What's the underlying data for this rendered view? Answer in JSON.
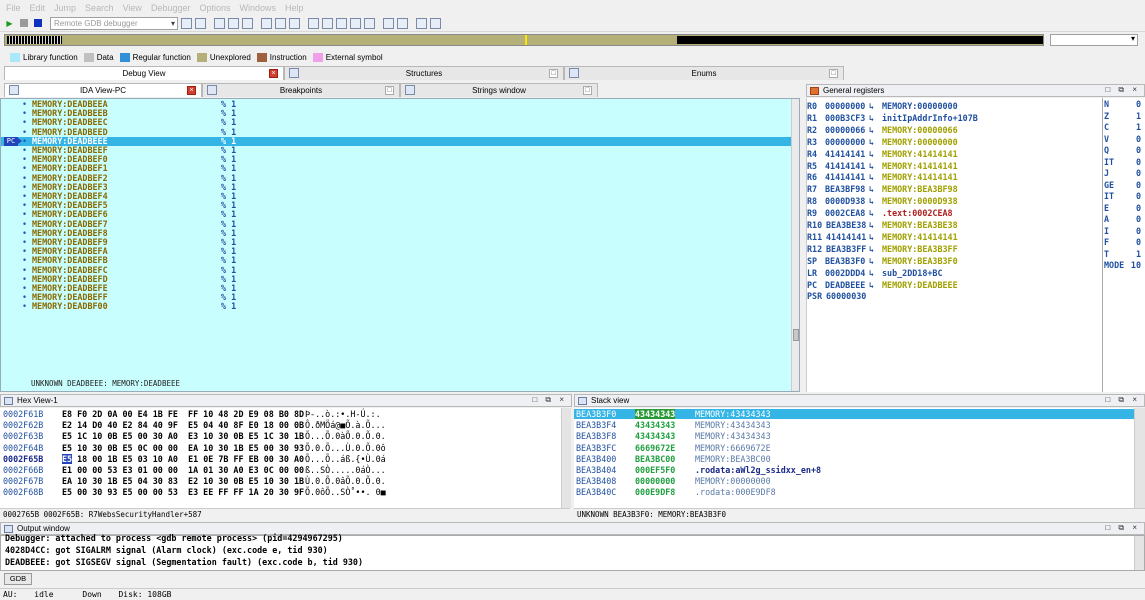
{
  "menu": [
    "File",
    "Edit",
    "Jump",
    "Search",
    "View",
    "Debugger",
    "Options",
    "Windows",
    "Help"
  ],
  "toolbar": {
    "debugger_select": "Remote GDB debugger"
  },
  "legend": [
    {
      "label": "Library function",
      "color": "#a8e8f8"
    },
    {
      "label": "Data",
      "color": "#c0c0c0"
    },
    {
      "label": "Regular function",
      "color": "#2f8fd8"
    },
    {
      "label": "Unexplored",
      "color": "#b5b07a"
    },
    {
      "label": "Instruction",
      "color": "#a06040"
    },
    {
      "label": "External symbol",
      "color": "#f0a0e8"
    }
  ],
  "top_tabs": [
    "Debug View",
    "Structures",
    "Enums"
  ],
  "sub_tabs": [
    "IDA View-PC",
    "Breakpoints",
    "Strings window"
  ],
  "ida_view": {
    "pc_label": "PC",
    "rows": [
      {
        "addr": "MEMORY:DEADBEEA",
        "op": "% 1"
      },
      {
        "addr": "MEMORY:DEADBEEB",
        "op": "% 1"
      },
      {
        "addr": "MEMORY:DEADBEEC",
        "op": "% 1"
      },
      {
        "addr": "MEMORY:DEADBEED",
        "op": "% 1"
      },
      {
        "addr": "MEMORY:DEADBEEE",
        "op": "% 1"
      },
      {
        "addr": "MEMORY:DEADBEEF",
        "op": "% 1"
      },
      {
        "addr": "MEMORY:DEADBEF0",
        "op": "% 1"
      },
      {
        "addr": "MEMORY:DEADBEF1",
        "op": "% 1"
      },
      {
        "addr": "MEMORY:DEADBEF2",
        "op": "% 1"
      },
      {
        "addr": "MEMORY:DEADBEF3",
        "op": "% 1"
      },
      {
        "addr": "MEMORY:DEADBEF4",
        "op": "% 1"
      },
      {
        "addr": "MEMORY:DEADBEF5",
        "op": "% 1"
      },
      {
        "addr": "MEMORY:DEADBEF6",
        "op": "% 1"
      },
      {
        "addr": "MEMORY:DEADBEF7",
        "op": "% 1"
      },
      {
        "addr": "MEMORY:DEADBEF8",
        "op": "% 1"
      },
      {
        "addr": "MEMORY:DEADBEF9",
        "op": "% 1"
      },
      {
        "addr": "MEMORY:DEADBEFA",
        "op": "% 1"
      },
      {
        "addr": "MEMORY:DEADBEFB",
        "op": "% 1"
      },
      {
        "addr": "MEMORY:DEADBEFC",
        "op": "% 1"
      },
      {
        "addr": "MEMORY:DEADBEFD",
        "op": "% 1"
      },
      {
        "addr": "MEMORY:DEADBEFE",
        "op": "% 1"
      },
      {
        "addr": "MEMORY:DEADBEFF",
        "op": "% 1"
      },
      {
        "addr": "MEMORY:DEADBF00",
        "op": "% 1"
      }
    ],
    "current_index": 4,
    "footer": "UNKNOWN DEADBEEE: MEMORY:DEADBEEE"
  },
  "registers": {
    "title": "General registers",
    "rows": [
      {
        "name": "R0",
        "value": "00000000",
        "target": "MEMORY:00000000",
        "color": "#2050a0"
      },
      {
        "name": "R1",
        "value": "000B3CF3",
        "target": "initIpAddrInfo+107B",
        "color": "#2050a0"
      },
      {
        "name": "R2",
        "value": "00000066",
        "target": "MEMORY:00000066",
        "color": "#a0a000"
      },
      {
        "name": "R3",
        "value": "00000000",
        "target": "MEMORY:00000000",
        "color": "#a0a000"
      },
      {
        "name": "R4",
        "value": "41414141",
        "target": "MEMORY:41414141",
        "color": "#a0a000"
      },
      {
        "name": "R5",
        "value": "41414141",
        "target": "MEMORY:41414141",
        "color": "#a0a000"
      },
      {
        "name": "R6",
        "value": "41414141",
        "target": "MEMORY:41414141",
        "color": "#a0a000"
      },
      {
        "name": "R7",
        "value": "BEA3BF98",
        "target": "MEMORY:BEA3BF98",
        "color": "#a0a000"
      },
      {
        "name": "R8",
        "value": "0000D938",
        "target": "MEMORY:0000D938",
        "color": "#a0a000"
      },
      {
        "name": "R9",
        "value": "0002CEA8",
        "target": ".text:0002CEA8",
        "color": "#b02020"
      },
      {
        "name": "R10",
        "value": "BEA3BE38",
        "target": "MEMORY:BEA3BE38",
        "color": "#a0a000"
      },
      {
        "name": "R11",
        "value": "41414141",
        "target": "MEMORY:41414141",
        "color": "#a0a000"
      },
      {
        "name": "R12",
        "value": "BEA3B3FF",
        "target": "MEMORY:BEA3B3FF",
        "color": "#a0a000"
      },
      {
        "name": "SP",
        "value": "BEA3B3F0",
        "target": "MEMORY:BEA3B3F0",
        "color": "#a0a000"
      },
      {
        "name": "LR",
        "value": "0002DDD4",
        "target": "sub_2DD18+BC",
        "color": "#2050a0"
      },
      {
        "name": "PC",
        "value": "DEADBEEE",
        "target": "MEMORY:DEADBEEE",
        "color": "#a0a000"
      },
      {
        "name": "PSR",
        "value": "60000030",
        "target": "",
        "color": "#2050a0"
      }
    ]
  },
  "flags": [
    {
      "name": "N",
      "value": "0"
    },
    {
      "name": "Z",
      "value": "1"
    },
    {
      "name": "C",
      "value": "1"
    },
    {
      "name": "V",
      "value": "0"
    },
    {
      "name": "Q",
      "value": "0"
    },
    {
      "name": "IT",
      "value": "0"
    },
    {
      "name": "J",
      "value": "0"
    },
    {
      "name": "GE",
      "value": "0"
    },
    {
      "name": "IT",
      "value": "0"
    },
    {
      "name": "E",
      "value": "0"
    },
    {
      "name": "A",
      "value": "0"
    },
    {
      "name": "I",
      "value": "0"
    },
    {
      "name": "F",
      "value": "0"
    },
    {
      "name": "T",
      "value": "1"
    },
    {
      "name": "MODE",
      "value": "10"
    }
  ],
  "hex_view": {
    "title": "Hex View-1",
    "rows": [
      {
        "addr": "0002F61B",
        "bytes": "E8 F0 2D 0A 00 E4 1B FE  FF 10 48 2D E9 08 B0 8D",
        "ascii": "Þ-..ò.:•.H-Ú.:."
      },
      {
        "addr": "0002F62B",
        "bytes": "E2 14 D0 40 E2 84 40 9F  E5 04 40 8F E0 18 00 0B",
        "ascii": "Ô.ðMÖá@■Õ.à.Õ..."
      },
      {
        "addr": "0002F63B",
        "bytes": "E5 1C 10 0B E5 00 30 A0  E3 10 30 0B E5 1C 30 1B",
        "ascii": "Õ...Õ.0àÕ.0.Õ.0."
      },
      {
        "addr": "0002F64B",
        "bytes": "E5 10 30 0B E5 0C 00 00  EA 10 30 1B E5 00 30 93",
        "ascii": "Õ.0.Õ...Ù.0.Õ.0ô"
      },
      {
        "addr": "0002F65B",
        "bytes": "E5 18 00 1B E5 03 10 A0  E1 0E 7B FF EB 00 30 A0",
        "ascii": "Õ...Õ..áß.{•Ù.0á",
        "cursor": true
      },
      {
        "addr": "0002F66B",
        "bytes": "E1 00 00 53 E3 01 00 00  1A 01 30 A0 E3 0C 00 00",
        "ascii": "ß..SÒ.....0áÒ..."
      },
      {
        "addr": "0002F67B",
        "bytes": "EA 10 30 1B E5 04 30 83  E2 10 30 0B E5 10 30 1B",
        "ascii": "Ù.0.Õ.0âÕ.0.Õ.0."
      },
      {
        "addr": "0002F68B",
        "bytes": "E5 00 30 93 E5 00 00 53  E3 EE FF FF 1A 20 30 9F",
        "ascii": "Õ.0ôÕ..SÒ˚••. 0■"
      }
    ],
    "footer": "0002765B 0002F65B: R7WebsSecurityHandler+587"
  },
  "stack_view": {
    "title": "Stack view",
    "rows": [
      {
        "addr": "BEA3B3F0",
        "value": "43434343",
        "comment": "MEMORY:43434343"
      },
      {
        "addr": "BEA3B3F4",
        "value": "43434343",
        "comment": "MEMORY:43434343"
      },
      {
        "addr": "BEA3B3F8",
        "value": "43434343",
        "comment": "MEMORY:43434343"
      },
      {
        "addr": "BEA3B3FC",
        "value": "6669672E",
        "comment": "MEMORY:6669672E"
      },
      {
        "addr": "BEA3B400",
        "value": "BEA3BC00",
        "comment": "MEMORY:BEA3BC00"
      },
      {
        "addr": "BEA3B404",
        "value": "000EF5F0",
        "comment": ".rodata:aWl2g_ssidxx_en+8"
      },
      {
        "addr": "BEA3B408",
        "value": "00000000",
        "comment": "MEMORY:00000000"
      },
      {
        "addr": "BEA3B40C",
        "value": "000E9DF8",
        "comment": ".rodata:000E9DF8"
      }
    ],
    "footer": "UNKNOWN BEA3B3F0: MEMORY:BEA3B3F0"
  },
  "output": {
    "title": "Output window",
    "lines": [
      "Debugger: attached to process <gdb remote process> (pid=4294967295)",
      "4028D4CC: got SIGALRM signal (Alarm clock) (exc.code e, tid 930)",
      "DEADBEEE: got SIGSEGV signal (Segmentation fault) (exc.code b, tid 930)"
    ],
    "gdb_button": "GDB"
  },
  "status": {
    "au": "AU:",
    "state": "idle",
    "dir": "Down",
    "disk": "Disk: 108GB"
  }
}
